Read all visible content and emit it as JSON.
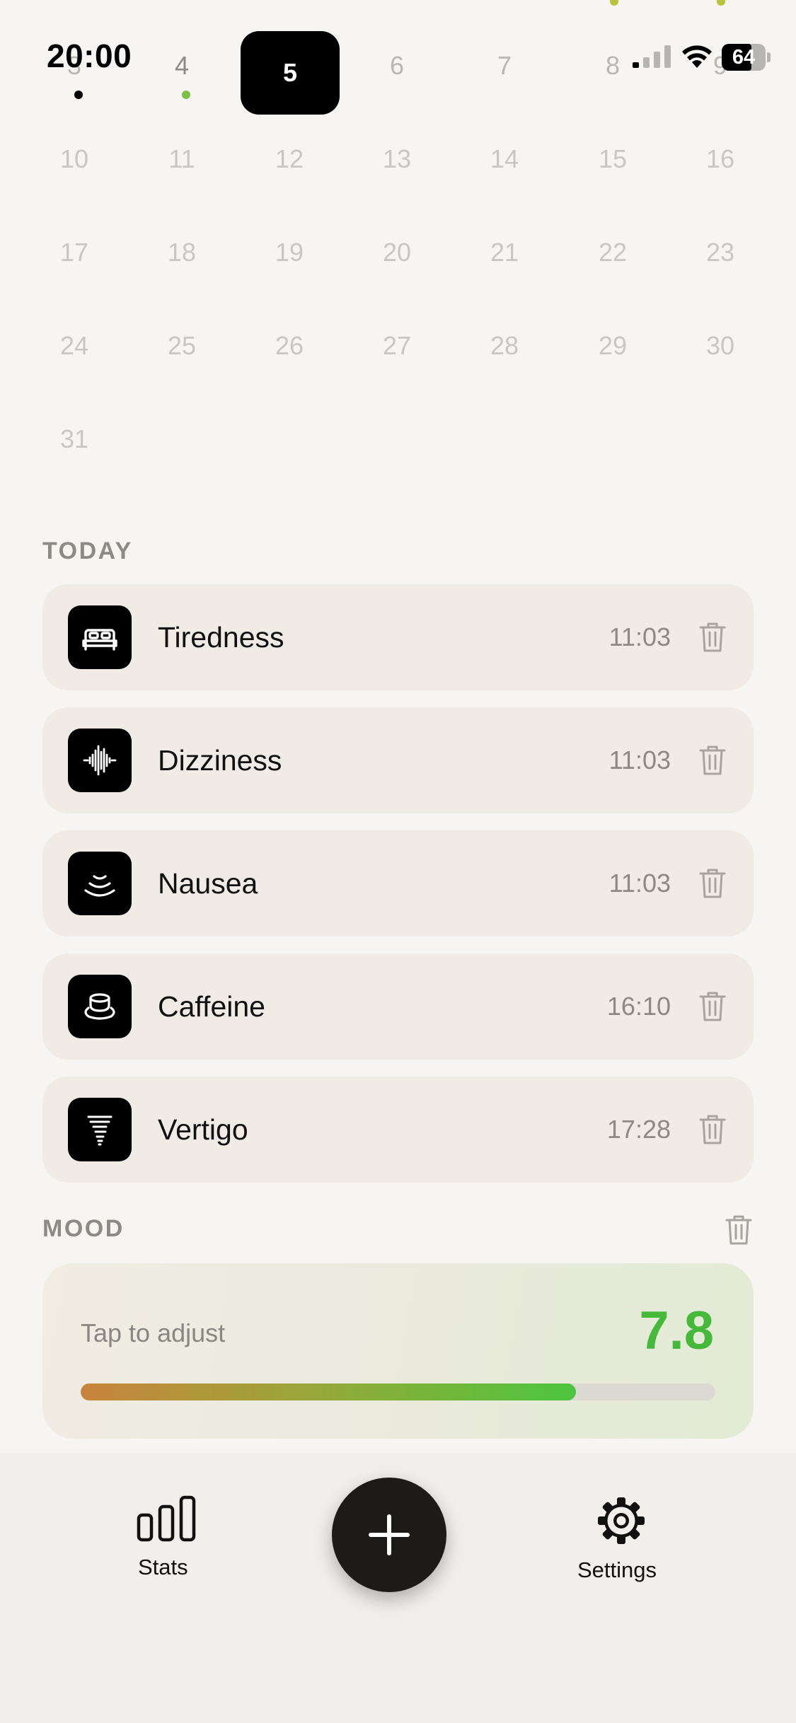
{
  "status_bar": {
    "time": "20:00",
    "battery": "64"
  },
  "calendar": {
    "weeks": [
      [
        "3",
        "4",
        "5",
        "6",
        "7",
        "8",
        "9"
      ],
      [
        "10",
        "11",
        "12",
        "13",
        "14",
        "15",
        "16"
      ],
      [
        "17",
        "18",
        "19",
        "20",
        "21",
        "22",
        "23"
      ],
      [
        "24",
        "25",
        "26",
        "27",
        "28",
        "29",
        "30"
      ],
      [
        "31"
      ]
    ],
    "selected_day": "5",
    "colors": {
      "selected_bg": "#000000",
      "dot_black": "#000000",
      "dot_green": "#7ac143",
      "dot_yellow_green": "#b8c43a"
    }
  },
  "today": {
    "label": "TODAY",
    "entries": [
      {
        "name": "Tiredness",
        "time": "11:03",
        "icon": "bed-icon"
      },
      {
        "name": "Dizziness",
        "time": "11:03",
        "icon": "waveform-icon"
      },
      {
        "name": "Nausea",
        "time": "11:03",
        "icon": "waves-icon"
      },
      {
        "name": "Caffeine",
        "time": "16:10",
        "icon": "coffee-cup-icon"
      },
      {
        "name": "Vertigo",
        "time": "17:28",
        "icon": "tornado-icon"
      }
    ]
  },
  "mood": {
    "label": "MOOD",
    "hint": "Tap to adjust",
    "value": "7.8",
    "level_fraction": 0.78,
    "value_color": "#44b93a"
  },
  "tabbar": {
    "stats_label": "Stats",
    "settings_label": "Settings",
    "add_icon": "plus-icon",
    "stats_icon": "bar-chart-icon",
    "settings_icon": "gear-icon"
  }
}
